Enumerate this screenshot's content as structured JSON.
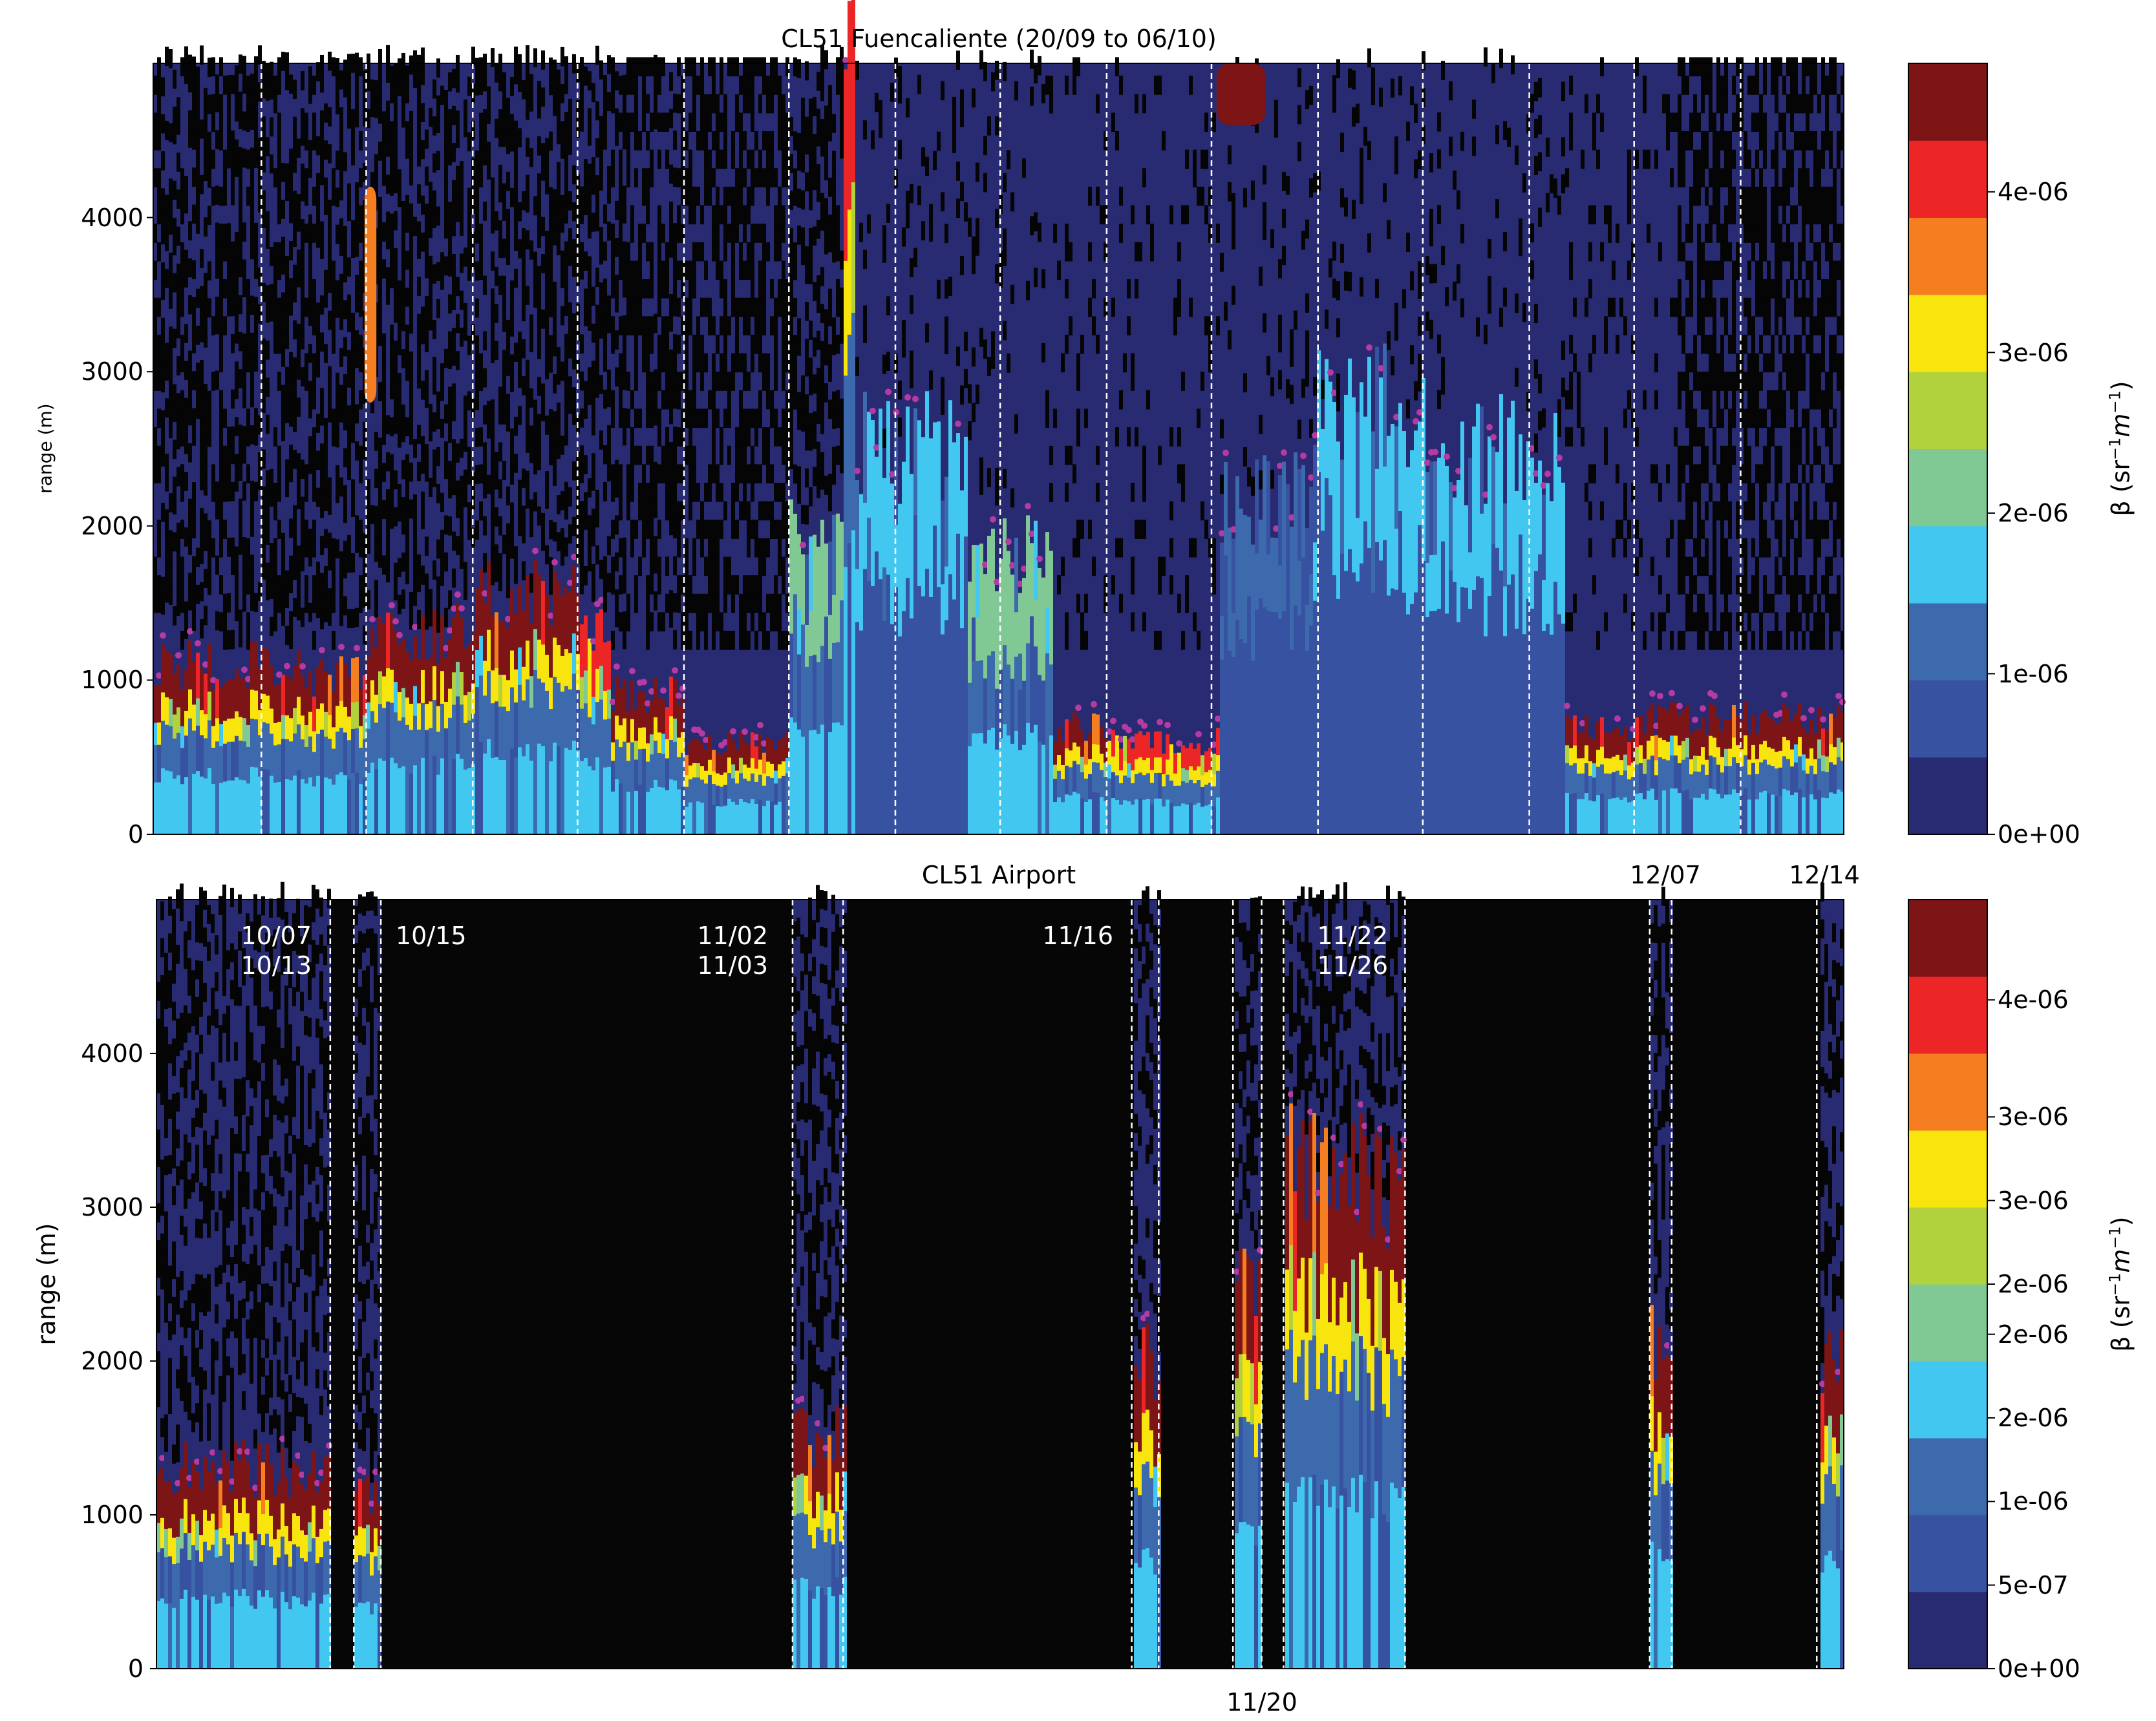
{
  "chart_data": [
    {
      "type": "heatmap",
      "title": "CL51 Fuencaliente (20/09 to 06/10)",
      "ylabel": "range (m)",
      "ylim": [
        0,
        5000
      ],
      "yticks": [
        "0",
        "1000",
        "2000",
        "3000",
        "4000"
      ],
      "ytick_values": [
        0,
        1000,
        2000,
        3000,
        4000
      ],
      "colorbar": {
        "label": "β (sr⁻¹m⁻¹)",
        "label_base": "β (sr",
        "range": [
          0,
          4.8e-06
        ],
        "ticks": [
          "0e+00",
          "1e-06",
          "2e-06",
          "3e-06",
          "4e-06"
        ],
        "tick_values": [
          0,
          1e-06,
          2e-06,
          3e-06,
          4e-06
        ]
      },
      "time_axis": "0-100 percent of period",
      "dashed_day_lines": [
        6.4,
        12.6,
        18.9,
        25.1,
        31.4,
        37.6,
        43.9,
        50.1,
        56.4,
        62.6,
        68.9,
        75.1,
        81.4,
        87.6,
        93.9
      ],
      "black_streak_density": [
        [
          0,
          41,
          0.55
        ],
        [
          41,
          90,
          0.12
        ],
        [
          90,
          100,
          0.6
        ]
      ],
      "aerosol_layers": [
        {
          "t": [
            0,
            6.5
          ],
          "top_m": 1100,
          "max_level": 10
        },
        {
          "t": [
            6.5,
            12.6
          ],
          "top_m": 1050,
          "max_level": 10
        },
        {
          "t": [
            12.6,
            18.9
          ],
          "top_m": 1300,
          "max_level": 10
        },
        {
          "t": [
            18.9,
            25.1
          ],
          "top_m": 1550,
          "max_level": 10
        },
        {
          "t": [
            25.1,
            27
          ],
          "top_m": 1300,
          "max_level": 8
        },
        {
          "t": [
            27,
            31.3
          ],
          "top_m": 900,
          "max_level": 10
        },
        {
          "t": [
            31.3,
            37.6
          ],
          "top_m": 600,
          "max_level": 10
        },
        {
          "t": [
            37.6,
            40.7
          ],
          "top_m": 2000,
          "max_level": 4
        },
        {
          "t": [
            40.7,
            41.5
          ],
          "top_m": 5000,
          "max_level": 10
        },
        {
          "t": [
            41.5,
            48
          ],
          "top_m": 2500,
          "max_level": 3
        },
        {
          "t": [
            48,
            53.1
          ],
          "top_m": 1800,
          "max_level": 4
        },
        {
          "t": [
            53.1,
            56.3
          ],
          "top_m": 700,
          "max_level": 10
        },
        {
          "t": [
            56.3,
            62.9
          ],
          "top_m": 600,
          "max_level": 8
        },
        {
          "t": [
            62.9,
            68.6
          ],
          "top_m": 2200,
          "max_level": 2
        },
        {
          "t": [
            68.6,
            75.1
          ],
          "top_m": 2800,
          "max_level": 3
        },
        {
          "t": [
            75.1,
            83.3
          ],
          "top_m": 2500,
          "max_level": 3
        },
        {
          "t": [
            83.3,
            88.2
          ],
          "top_m": 700,
          "max_level": 10
        },
        {
          "t": [
            88.2,
            100
          ],
          "top_m": 750,
          "max_level": 10
        }
      ],
      "upper_features": [
        {
          "t": [
            62.9,
            65.8
          ],
          "bottom_m": 4600,
          "top_m": 5000,
          "max_level": 10
        },
        {
          "t": [
            12.5,
            13.2
          ],
          "bottom_m": 2800,
          "top_m": 4200,
          "max_level": 7
        }
      ]
    },
    {
      "type": "heatmap",
      "title": "CL51 Airport",
      "ylabel": "range (m)",
      "ylim": [
        0,
        5000
      ],
      "yticks": [
        "0",
        "1000",
        "2000",
        "3000",
        "4000"
      ],
      "ytick_values": [
        0,
        1000,
        2000,
        3000,
        4000
      ],
      "colorbar": {
        "label": "β (sr⁻¹m⁻¹)",
        "label_base": "β (sr",
        "range": [
          0,
          4.6e-06
        ],
        "ticks": [
          "0e+00",
          "5e-07",
          "1e-06",
          "2e-06",
          "2e-06",
          "2e-06",
          "3e-06",
          "3e-06",
          "4e-06"
        ],
        "tick_values": [
          0,
          5e-07,
          1e-06,
          1.5e-06,
          2e-06,
          2.3e-06,
          2.8e-06,
          3.3e-06,
          4e-06
        ]
      },
      "time_axis": "0-100 percent of period",
      "dashed_day_lines": [
        10.3,
        11.7,
        13.3,
        37.7,
        40.7,
        57.8,
        59.4,
        63.8,
        65.5,
        66.8,
        74.0,
        88.5,
        89.8,
        98.4
      ],
      "data_segments": [
        {
          "t": [
            0,
            10.3
          ],
          "top_m": 1300,
          "max_level": 10
        },
        {
          "t": [
            11.7,
            13.3
          ],
          "top_m": 1150,
          "max_level": 10
        },
        {
          "t": [
            37.7,
            40.7
          ],
          "top_m": 1500,
          "max_level": 10
        },
        {
          "t": [
            57.8,
            59.4
          ],
          "top_m": 2000,
          "max_level": 10
        },
        {
          "t": [
            63.8,
            65.5
          ],
          "top_m": 2600,
          "max_level": 10
        },
        {
          "t": [
            66.8,
            74.0
          ],
          "top_m": 3200,
          "max_level": 10
        },
        {
          "t": [
            88.5,
            89.8
          ],
          "top_m": 2200,
          "max_level": 10
        },
        {
          "t": [
            98.4,
            100
          ],
          "top_m": 2000,
          "max_level": 10
        }
      ],
      "annotations": [
        {
          "text": "10/07\n10/13",
          "t": 9.3
        },
        {
          "text": "10/15",
          "t": 14.2
        },
        {
          "text": "11/02\n11/03",
          "t": 36.3
        },
        {
          "text": "11/16",
          "t": 56.8
        },
        {
          "text": "11/22\n11/26",
          "t": 73.0
        }
      ],
      "top_labels": [
        {
          "text": "12/07",
          "t": 89.4
        },
        {
          "text": "12/14",
          "t": 98.9
        }
      ],
      "xtick_labels": [
        {
          "text": "11/20",
          "t": 65.5
        }
      ]
    }
  ],
  "colors": {
    "levels": [
      "#282a72",
      "#3652a0",
      "#3d69ad",
      "#42c8f0",
      "#80c995",
      "#b1d23d",
      "#f8e50d",
      "#f57f20",
      "#ec2527",
      "#7d1416",
      "#7d1416"
    ],
    "no_data": "#060606",
    "dots": "#b53aa2",
    "dash": "#ffffff"
  }
}
